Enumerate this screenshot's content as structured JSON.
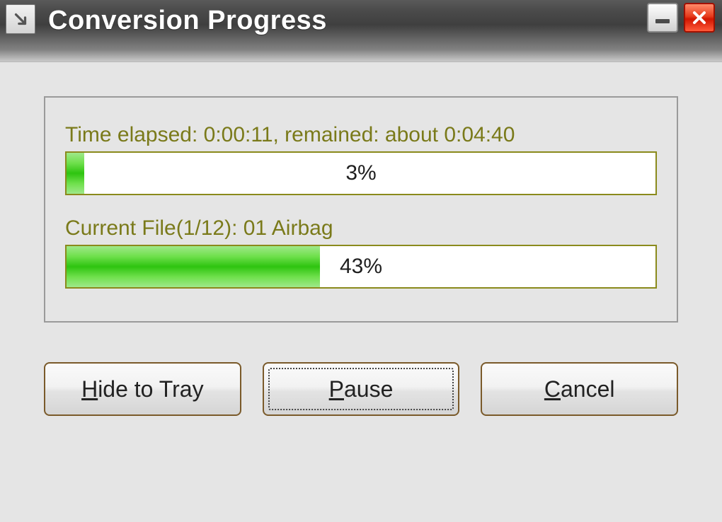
{
  "title": "Conversion Progress",
  "time_label": "Time elapsed: 0:00:11, remained: about 0:04:40",
  "overall": {
    "percent_text": "3%",
    "percent_value": 3
  },
  "file_label": "Current File(1/12): 01 Airbag",
  "file": {
    "percent_text": "43%",
    "percent_value": 43
  },
  "buttons": {
    "hide": "Hide to Tray",
    "pause": "Pause",
    "cancel": "Cancel"
  }
}
